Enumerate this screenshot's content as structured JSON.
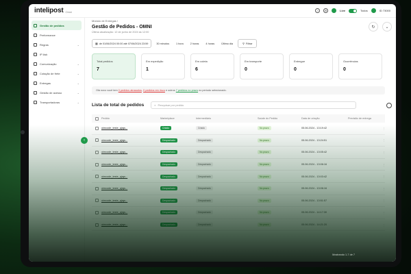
{
  "app": {
    "logo": "intelipost",
    "logo_sub": "Omni"
  },
  "topbar": {
    "live_label": "Live",
    "all_label": "Todos",
    "user_code": "ID 73000"
  },
  "sidebar": {
    "items": [
      {
        "label": "Gestão de pedidos",
        "active": true,
        "chevron": false
      },
      {
        "label": "Performance",
        "chevron": false
      },
      {
        "label": "Regras",
        "chevron": true
      },
      {
        "label": "IP Ask",
        "chevron": false
      },
      {
        "label": "Comunicação",
        "chevron": true
      },
      {
        "label": "Cotação de frete",
        "chevron": true
      },
      {
        "label": "Entregas",
        "chevron": true
      },
      {
        "label": "Gestão de acesso",
        "chevron": true
      },
      {
        "label": "Transportadoras",
        "chevron": true
      }
    ]
  },
  "header": {
    "breadcrumb": "Módulo de Entregas  /",
    "title": "Gestão de Pedidos - OMNI",
    "updated": "Última atualização: 12 de junho de 2024 às 12:00"
  },
  "filters": {
    "date_range": "de 01/06/2024 00:00 até 07/06/2024 23:59",
    "ranges": [
      "30 minutos",
      "1 hora",
      "2 horas",
      "4 horas",
      "Último dia"
    ],
    "filter_label": "Filtrar"
  },
  "cards": [
    {
      "label": "Total pedidos",
      "value": "7",
      "active": true
    },
    {
      "label": "Em expedição",
      "value": "1"
    },
    {
      "label": "Em coleta",
      "value": "6"
    },
    {
      "label": "Em transporte",
      "value": "0"
    },
    {
      "label": "Entregue",
      "value": "0"
    },
    {
      "label": "Ocorrências",
      "value": "0"
    }
  ],
  "notice": {
    "prefix": "Olá novo você tem ",
    "red_1": "0 pedidos atrasados",
    "mid_1": ", ",
    "red_2": "0 pedidos em risco",
    "mid_2": " e outros ",
    "green": "7 pedidos no prazo",
    "suffix": " no período selecionado."
  },
  "list": {
    "title": "Lista de total de pedidos",
    "search_placeholder": "Pesquisar por pedido",
    "columns": [
      "Pedido",
      "Marketplace",
      "Intermediário",
      "Saúde do Pedido",
      "Data de criação",
      "Previsão de entrega"
    ],
    "rows": [
      {
        "pedido": "oimcode_teste_qjrgs...",
        "mkt": "Criado",
        "mkt_style": "green",
        "int": "Criado",
        "saude": "No prazo",
        "data": "05.06.2024 - 13:19:42"
      },
      {
        "pedido": "oimcode_teste_qjrgs...",
        "mkt": "Despachado",
        "mkt_style": "green",
        "int": "Despachado",
        "saude": "No prazo",
        "data": "05.06.2024 - 13:24:51"
      },
      {
        "pedido": "oimcode_teste_qjrgs...",
        "mkt": "Despachado",
        "mkt_style": "green",
        "int": "Despachado",
        "saude": "No prazo",
        "data": "05.06.2024 - 13:05:42"
      },
      {
        "pedido": "oimcode_teste_qjrgs...",
        "mkt": "Despachado",
        "mkt_style": "green",
        "int": "Despachado",
        "saude": "No prazo",
        "data": "05.06.2024 - 13:06:16"
      },
      {
        "pedido": "oimcode_teste_qjrgs...",
        "mkt": "Despachado",
        "mkt_style": "green",
        "int": "Despachado",
        "saude": "No prazo",
        "data": "05.06.2024 - 13:03:42"
      },
      {
        "pedido": "oimcode_teste_qjrgs...",
        "mkt": "Despachado",
        "mkt_style": "green",
        "int": "Despachado",
        "saude": "No prazo",
        "data": "05.06.2024 - 13:06:16"
      },
      {
        "pedido": "oimcode_teste_qjrgs...",
        "mkt": "Despachado",
        "mkt_style": "green",
        "int": "Despachado",
        "saude": "No prazo",
        "data": "05.06.2024 - 13:51:57"
      },
      {
        "pedido": "oimcode_teste_qjrgs...",
        "mkt": "Despachado",
        "mkt_style": "green",
        "int": "Despachado",
        "saude": "No prazo",
        "data": "05.06.2024 - 14:17:30"
      },
      {
        "pedido": "oimcode_teste_qjrgs...",
        "mkt": "Despachado",
        "mkt_style": "green",
        "int": "Despachado",
        "saude": "No prazo",
        "data": "05.06.2024 - 14:21:20"
      }
    ],
    "pagination": "Mostrando 1-7 de 7"
  }
}
